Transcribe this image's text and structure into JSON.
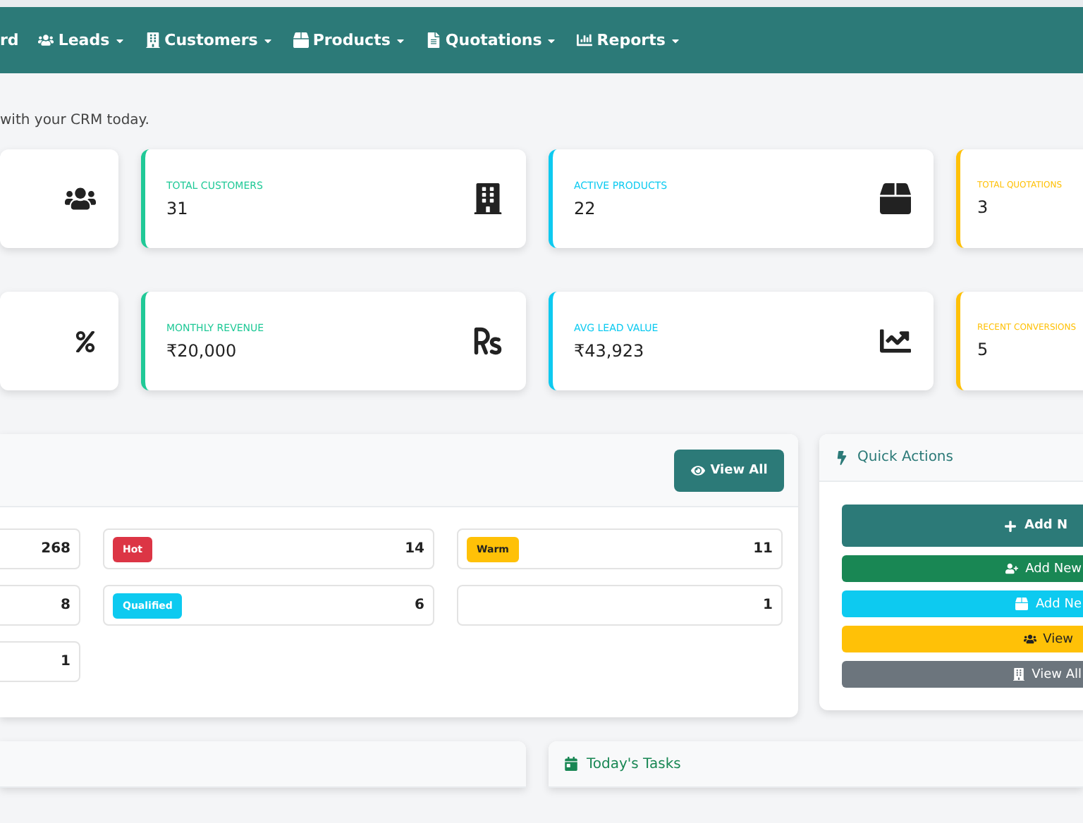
{
  "navbar": {
    "items": [
      {
        "label": "rd"
      },
      {
        "label": "Leads"
      },
      {
        "label": "Customers"
      },
      {
        "label": "Products"
      },
      {
        "label": "Quotations"
      },
      {
        "label": "Reports"
      }
    ]
  },
  "subtitle": "with your CRM today.",
  "stat_rows": [
    [
      {},
      {
        "title": "TOTAL CUSTOMERS",
        "value": "31",
        "color": "#20c997"
      },
      {
        "title": "ACTIVE PRODUCTS",
        "value": "22",
        "color": "#0dcaf0"
      },
      {
        "title": "TOTAL QUOTATIONS",
        "value": "3",
        "color": "#ffc107"
      }
    ],
    [
      {},
      {
        "title": "MONTHLY REVENUE",
        "value": "₹20,000",
        "color": "#20c997"
      },
      {
        "title": "AVG LEAD VALUE",
        "value": "₹43,923",
        "color": "#0dcaf0"
      },
      {
        "title": "RECENT CONVERSIONS",
        "value": "5",
        "color": "#ffc107"
      }
    ]
  ],
  "lead_panel": {
    "button": "View All",
    "stats": [
      {
        "count": "268"
      },
      {
        "badge": "Hot",
        "color": "#dc3545",
        "count": "14"
      },
      {
        "badge": "Warm",
        "color": "#ffc107",
        "count": "11"
      },
      {
        "count": "8"
      },
      {
        "badge": "Qualified",
        "color": "#0dcaf0",
        "count": "6"
      },
      {
        "count": "1"
      },
      {
        "count": "1"
      }
    ]
  },
  "quick_actions": {
    "title": "Quick Actions",
    "buttons": [
      {
        "label": "Add N",
        "color": "#2c7a78"
      },
      {
        "label": "Add New",
        "color": "#198754"
      },
      {
        "label": "Add Ne",
        "color": "#0dcaf0"
      },
      {
        "label": "View",
        "color": "#ffc107"
      },
      {
        "label": "View All",
        "color": "#6c757d"
      }
    ]
  },
  "tasks_panel": {
    "title": "Today's Tasks"
  }
}
